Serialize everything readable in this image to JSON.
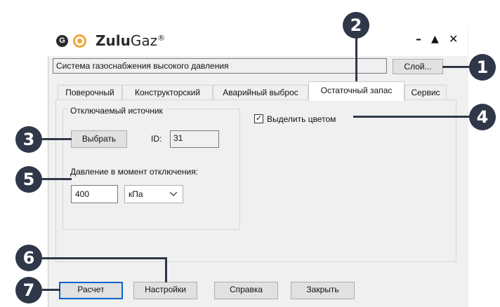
{
  "window": {
    "title_bold": "Zulu",
    "title_light": "Gaz",
    "title_reg": "®",
    "logo_letter": "G",
    "minimize": "–",
    "maximize": "▲",
    "close": "✕"
  },
  "system_field": {
    "value": "Система газоснабжения высокого давления"
  },
  "layer_button": {
    "label": "Слой..."
  },
  "tabs": [
    {
      "label": "Поверочный"
    },
    {
      "label": "Конструкторский"
    },
    {
      "label": "Аварийный выброс"
    },
    {
      "label": "Остаточный запас",
      "active": true
    },
    {
      "label": "Сервис"
    }
  ],
  "source_group": {
    "legend": "Отключаемый источник",
    "select_button": "Выбрать",
    "id_label": "ID:",
    "id_value": "31",
    "pressure_label": "Давление в момент отключения:",
    "pressure_value": "400",
    "unit_selected": "кПа"
  },
  "highlight": {
    "label": "Выделить цветом",
    "checked": true,
    "mark": "✓"
  },
  "buttons": {
    "calc": "Расчет",
    "settings": "Настройки",
    "help": "Справка",
    "close": "Закрыть"
  },
  "callouts": [
    "1",
    "2",
    "3",
    "4",
    "5",
    "6",
    "7"
  ],
  "colors": {
    "callout": "#2f3748",
    "accent_focus": "#0a64c8",
    "logo_orange": "#f3a63a"
  }
}
